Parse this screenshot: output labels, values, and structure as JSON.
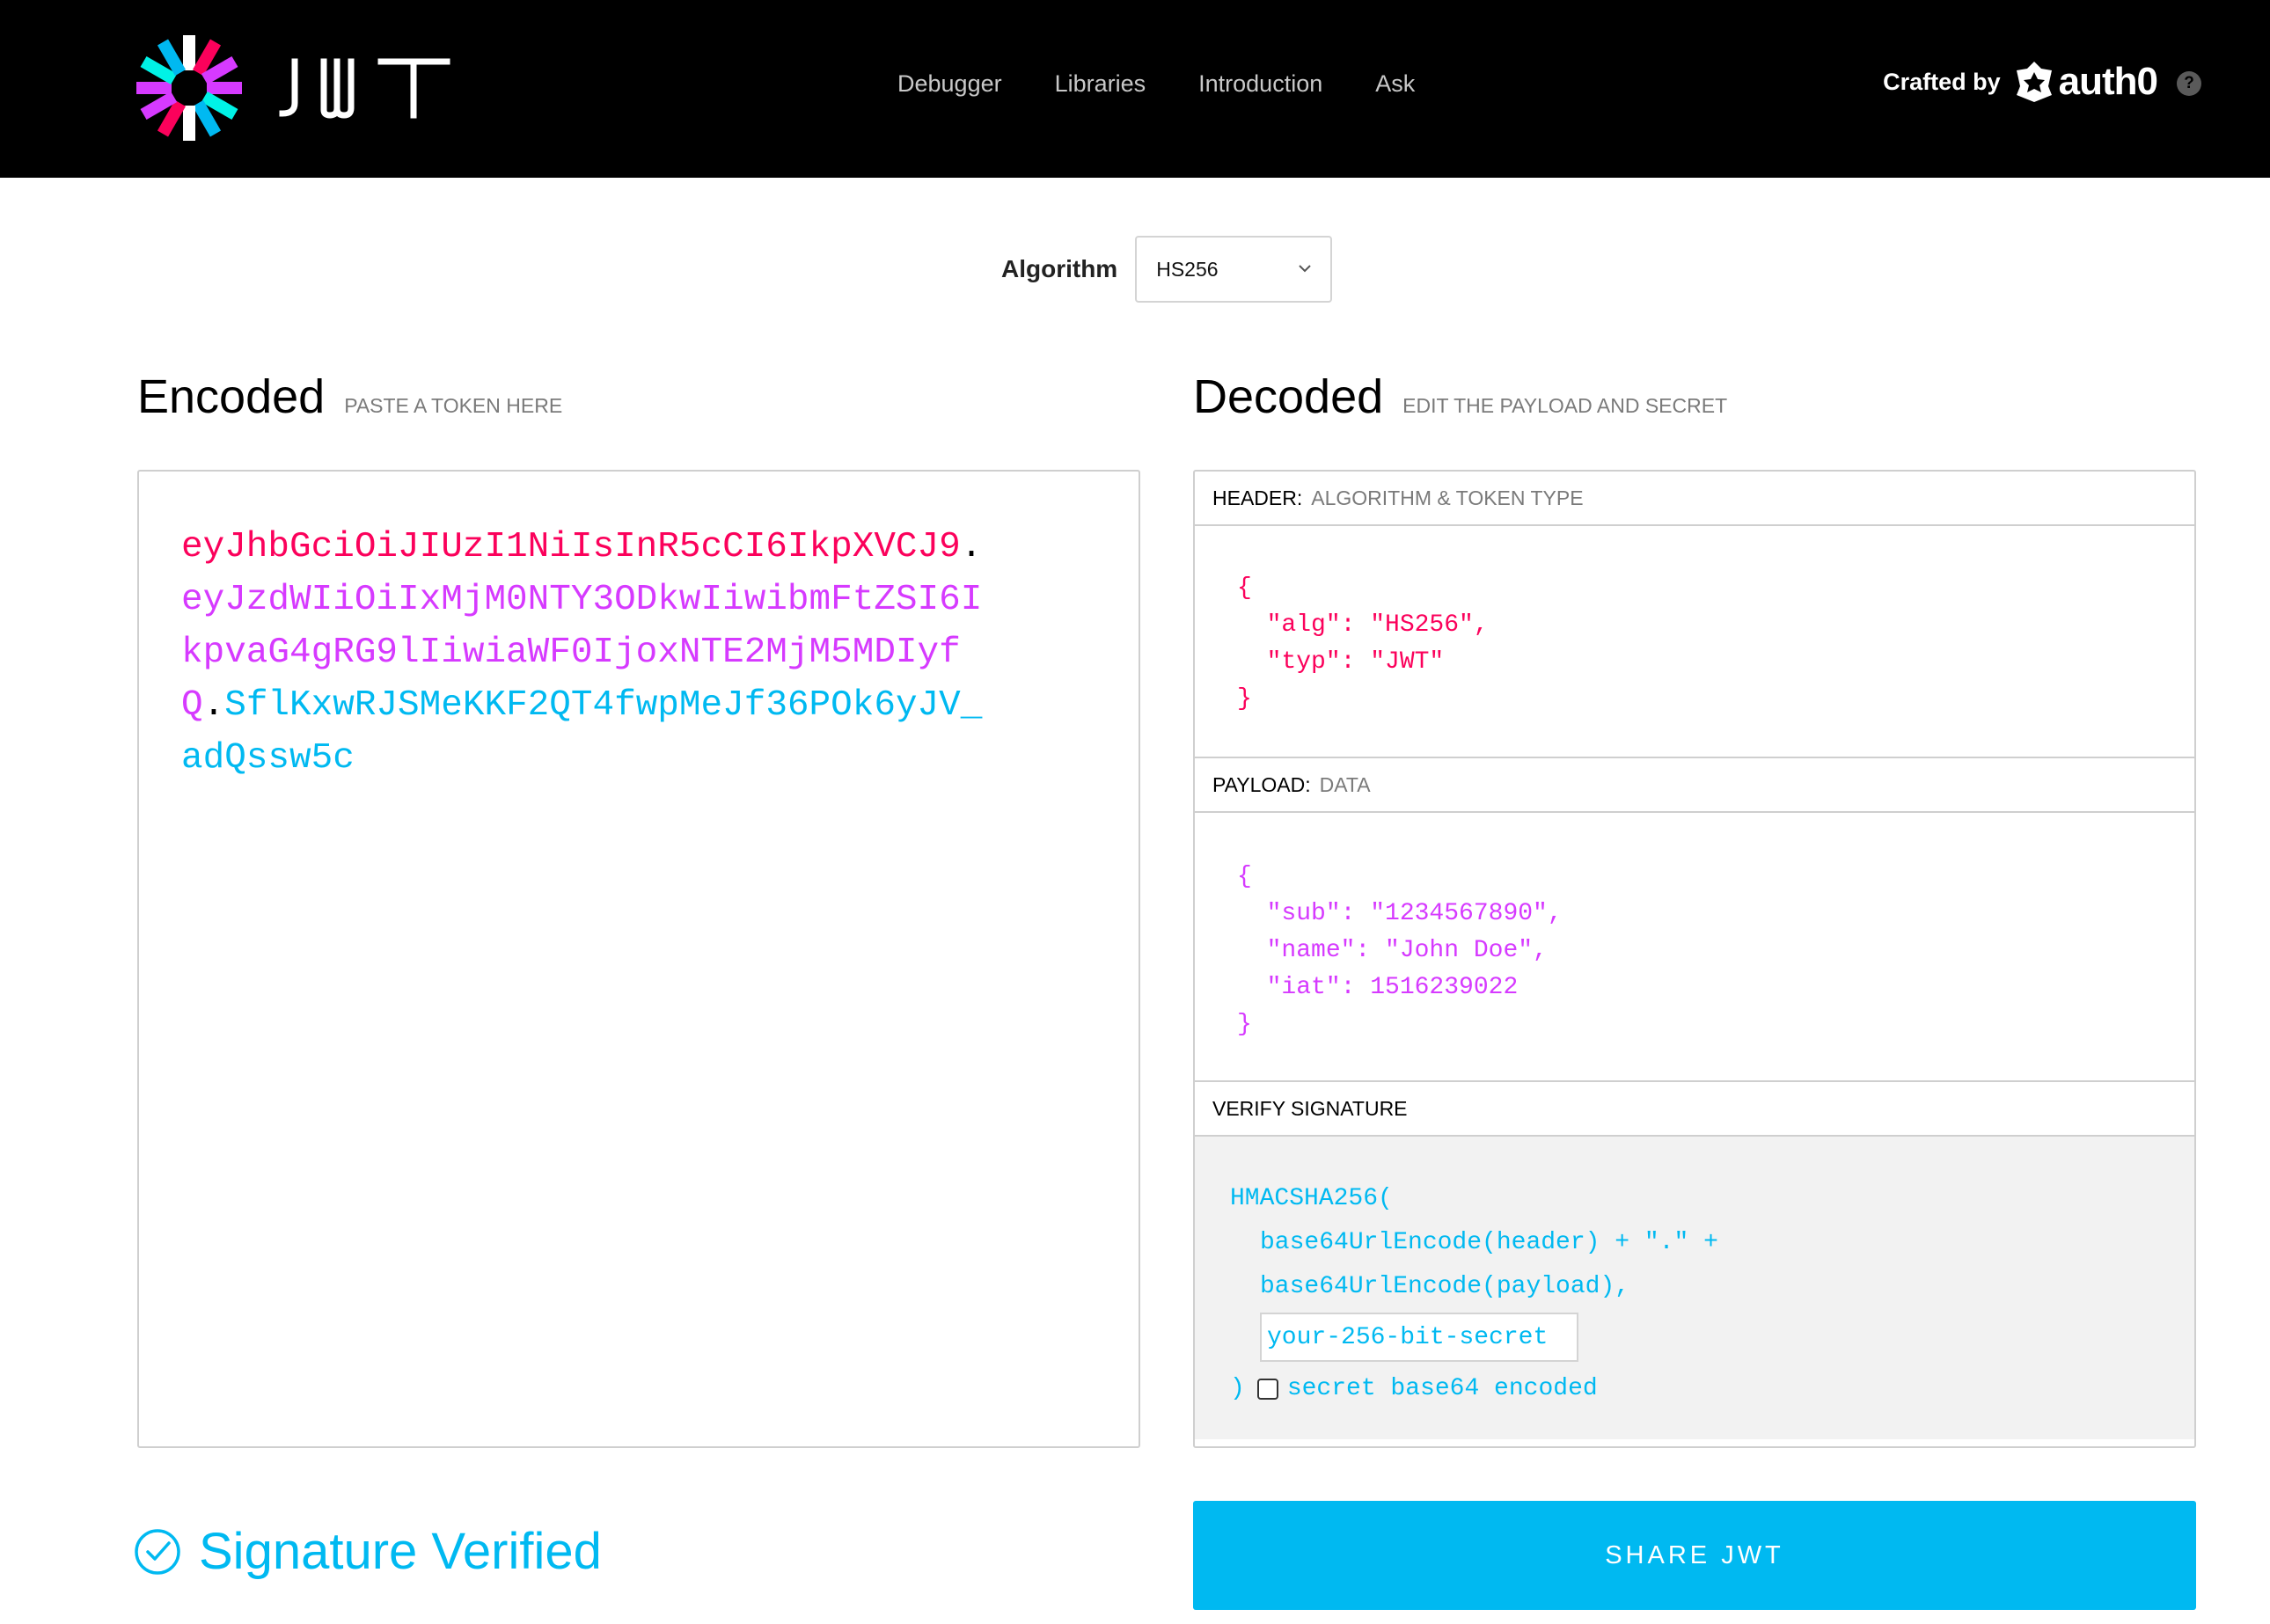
{
  "brand": {
    "logo_text": "JWT"
  },
  "nav": {
    "links": [
      "Debugger",
      "Libraries",
      "Introduction",
      "Ask"
    ],
    "crafted_by": "Crafted by",
    "auth0": "auth0",
    "help": "?"
  },
  "algorithm": {
    "label": "Algorithm",
    "value": "HS256"
  },
  "encoded": {
    "title": "Encoded",
    "subtitle": "PASTE A TOKEN HERE",
    "token_header": "eyJhbGciOiJIUzI1NiIsInR5cCI6IkpXVCJ9",
    "token_payload": "eyJzdWIiOiIxMjM0NTY3ODkwIiwibmFtZSI6IkpvaG4gRG9lIiwiaWF0IjoxNTE2MjM5MDIyfQ",
    "token_signature": "SflKxwRJSMeKKF2QT4fwpMeJf36POk6yJV_adQssw5c",
    "dot": "."
  },
  "decoded": {
    "title": "Decoded",
    "subtitle": "EDIT THE PAYLOAD AND SECRET",
    "header_label": "HEADER:",
    "header_desc": "ALGORITHM & TOKEN TYPE",
    "header_json": "{\n  \"alg\": \"HS256\",\n  \"typ\": \"JWT\"\n}",
    "payload_label": "PAYLOAD:",
    "payload_desc": "DATA",
    "payload_json": "{\n  \"sub\": \"1234567890\",\n  \"name\": \"John Doe\",\n  \"iat\": 1516239022\n}",
    "verify_label": "VERIFY SIGNATURE",
    "sig_fn": "HMACSHA256(",
    "sig_line1": "base64UrlEncode(header) + \".\" +",
    "sig_line2": "base64UrlEncode(payload),",
    "secret_placeholder": "your-256-bit-secret",
    "sig_close": ")",
    "base64_label": "secret base64 encoded"
  },
  "status": {
    "text": "Signature Verified",
    "color": "#00b9f1"
  },
  "share_button": "SHARE JWT",
  "colors": {
    "header": "#fb015b",
    "payload": "#d63aff",
    "signature": "#00b9f1"
  }
}
